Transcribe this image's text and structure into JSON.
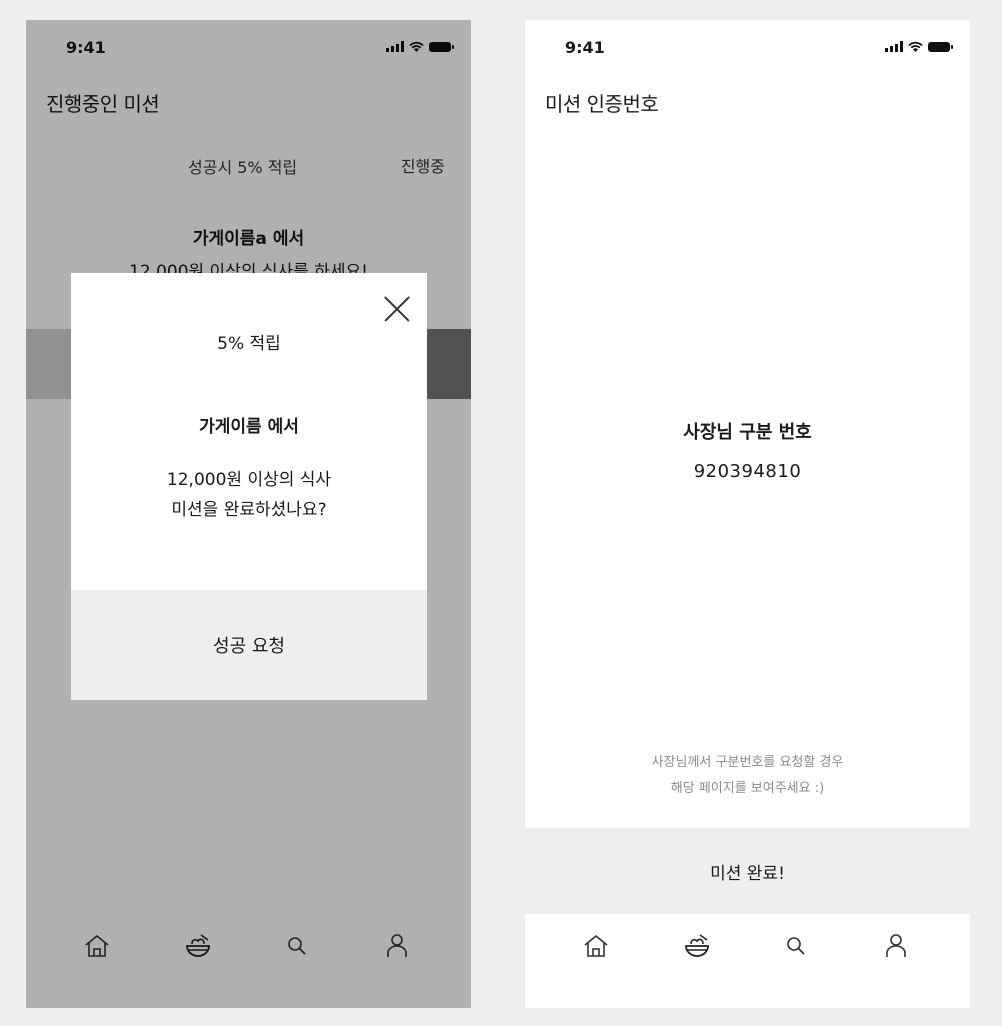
{
  "left": {
    "status": {
      "time": "9:41"
    },
    "header": {
      "title": "진행중인 미션"
    },
    "mission": {
      "reward": "성공시 5% 적립",
      "state": "진행중",
      "store": "가게이름a 에서",
      "desc": "12,000원 이상의 식사를 하세요!"
    },
    "modal": {
      "reward": "5% 적립",
      "store": "가게이름 에서",
      "line1": "12,000원 이상의 식사",
      "line2": "미션을 완료하셨나요?",
      "action": "성공 요청"
    }
  },
  "right": {
    "status": {
      "time": "9:41"
    },
    "header": {
      "title": "미션 인증번호"
    },
    "code": {
      "title": "사장님 구분 번호",
      "value": "920394810"
    },
    "hint": {
      "line1": "사장님께서 구분번호를 요청할 경우",
      "line2": "해당 페이지를 보여주세요 :)"
    },
    "complete": "미션 완료!"
  },
  "tabs": [
    "home-icon",
    "food-bowl-icon",
    "search-icon",
    "profile-icon"
  ]
}
